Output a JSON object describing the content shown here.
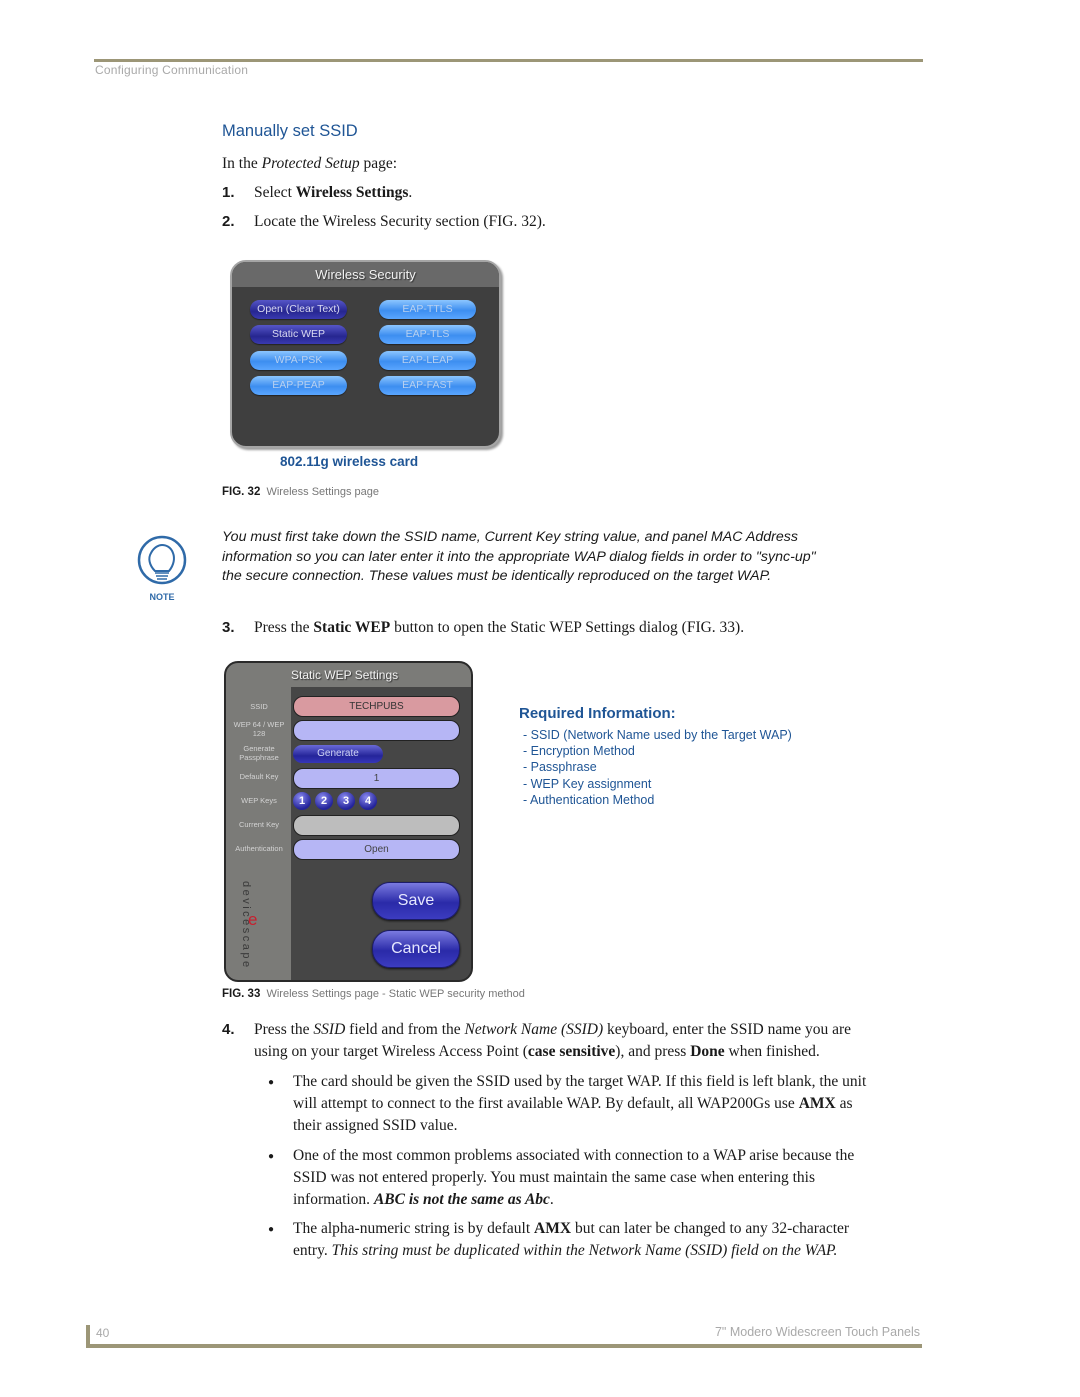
{
  "header": {
    "section": "Configuring Communication"
  },
  "section_title": "Manually set SSID",
  "intro": {
    "pre": "In the ",
    "em": "Protected Setup",
    "post": " page:"
  },
  "steps": [
    {
      "num": "1.",
      "pre": "Select ",
      "bold": "Wireless Settings",
      "post": "."
    },
    {
      "num": "2.",
      "text": "Locate the Wireless Security section (FIG. 32)."
    },
    {
      "num": "3.",
      "pre": "Press the ",
      "bold": "Static WEP",
      "post": " button to open the Static WEP Settings dialog (FIG. 33)."
    },
    {
      "num": "4.",
      "line1_a": "Press the ",
      "line1_em1": "SSID",
      "line1_b": " field and from the ",
      "line1_em2": "Network Name (SSID)",
      "line1_c": " keyboard, enter the SSID name you are",
      "line2_a": "using on your target Wireless Access Point (",
      "line2_bold1": "case sensitive",
      "line2_b": "), and press ",
      "line2_bold2": "Done",
      "line2_c": " when finished."
    }
  ],
  "fig32": {
    "panel_title": "Wireless Security",
    "buttons": [
      {
        "label": "Open (Clear Text)",
        "style": "selected"
      },
      {
        "label": "EAP-TTLS",
        "style": "normal"
      },
      {
        "label": "Static WEP",
        "style": "selected"
      },
      {
        "label": "EAP-TLS",
        "style": "normal"
      },
      {
        "label": "WPA-PSK",
        "style": "normal"
      },
      {
        "label": "EAP-LEAP",
        "style": "normal"
      },
      {
        "label": "EAP-PEAP",
        "style": "normal"
      },
      {
        "label": "EAP-FAST",
        "style": "normal"
      }
    ],
    "sublabel": "802.11g wireless card",
    "caption_num": "FIG. 32",
    "caption_text": "Wireless Settings page"
  },
  "note": {
    "icon_label": "NOTE",
    "text": "You must first take down the SSID name, Current Key string value, and panel MAC Address information so you can later enter it into the appropriate WAP dialog fields in order to \"sync-up\" the secure connection. These values must be identically reproduced on the target WAP."
  },
  "fig33": {
    "panel_title": "Static WEP Settings",
    "labels": {
      "ssid": "SSID",
      "wep": "WEP 64 / WEP 128",
      "generate": "Generate Passphrase",
      "default_key": "Default Key",
      "wep_keys": "WEP Keys",
      "current_key": "Current Key",
      "authentication": "Authentication"
    },
    "ssid_value": "TECHPUBS",
    "wep_value": "",
    "generate_button": "Generate",
    "default_key_value": "1",
    "wep_key_buttons": [
      "1",
      "2",
      "3",
      "4"
    ],
    "current_key_value": "",
    "authentication_value": "Open",
    "save_button": "Save",
    "cancel_button": "Cancel",
    "brand_text": "devicescape",
    "brand_mark": "e",
    "caption_num": "FIG. 33",
    "caption_text": "Wireless Settings page - Static WEP security method"
  },
  "required_info": {
    "title": "Required Information:",
    "items": [
      "- SSID (Network Name used by the Target WAP)",
      "- Encryption Method",
      "- Passphrase",
      "- WEP Key assignment",
      "- Authentication Method"
    ]
  },
  "bullets": [
    {
      "l1": "The card should be given the SSID used by the target WAP. If this field is left blank, the unit",
      "l2a": "will attempt to connect to the first available WAP. By default, all WAP200Gs use ",
      "l2b": "AMX",
      "l2c": " as",
      "l3": "their assigned SSID value."
    },
    {
      "l1": "One of the most common problems associated with connection to a WAP arise because the",
      "l2": "SSID was not entered properly. You must maintain the same case when entering this",
      "l3a": "information. ",
      "l3b": "ABC is not the same as Abc",
      "l3c": "."
    },
    {
      "l1a": "The alpha-numeric string is by default ",
      "l1b": "AMX",
      "l1c": " but can later be changed to any 32-character",
      "l2a": "entry. ",
      "l2b": "This string must be duplicated within the Network Name (SSID) field on the WAP."
    }
  ],
  "footer": {
    "page": "40",
    "title": "7\" Modero Widescreen Touch Panels"
  }
}
